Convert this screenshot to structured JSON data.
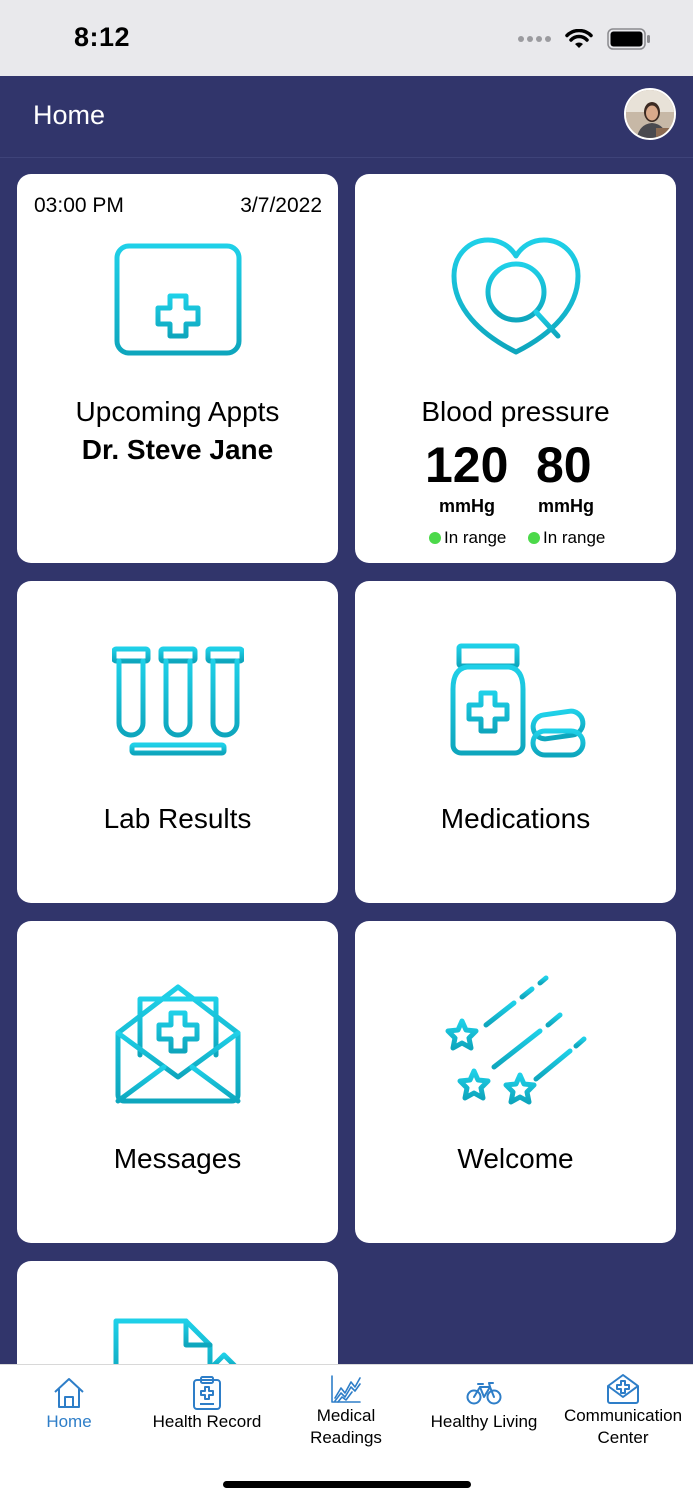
{
  "status_bar": {
    "time": "8:12",
    "icons": [
      "signal-dots-icon",
      "wifi-icon",
      "battery-icon"
    ]
  },
  "nav": {
    "title": "Home",
    "avatar": "user-avatar"
  },
  "colors": {
    "navy": "#31356b",
    "accent_teal": "#17b8d6",
    "tab_active": "#2e7ec8",
    "in_range": "#4cd94a"
  },
  "cards": {
    "appointments": {
      "time": "03:00 PM",
      "date": "3/7/2022",
      "title": "Upcoming Appts",
      "doctor": "Dr. Steve Jane",
      "icon": "calendar-medical-icon"
    },
    "blood_pressure": {
      "title": "Blood pressure",
      "systolic": {
        "value": "120",
        "unit": "mmHg",
        "status": "In range"
      },
      "diastolic": {
        "value": "80",
        "unit": "mmHg",
        "status": "In range"
      },
      "icon": "heart-search-icon"
    },
    "lab_results": {
      "label": "Lab Results",
      "icon": "test-tubes-icon"
    },
    "medications": {
      "label": "Medications",
      "icon": "pill-bottle-icon"
    },
    "messages": {
      "label": "Messages",
      "icon": "medical-envelope-icon"
    },
    "welcome": {
      "label": "Welcome",
      "icon": "shooting-stars-icon"
    },
    "documents": {
      "label": "",
      "icon": "document-icon"
    }
  },
  "tab_bar": {
    "tabs": [
      {
        "line1": "Home",
        "line2": "",
        "icon": "home-icon",
        "active": true
      },
      {
        "line1": "Health Record",
        "line2": "",
        "icon": "clipboard-medical-icon",
        "active": false
      },
      {
        "line1": "Medical",
        "line2": "Readings",
        "icon": "chart-readings-icon",
        "active": false
      },
      {
        "line1": "Healthy Living",
        "line2": "",
        "icon": "bicycle-icon",
        "active": false
      },
      {
        "line1": "Communication",
        "line2": "Center",
        "icon": "message-medical-icon",
        "active": false
      }
    ]
  }
}
